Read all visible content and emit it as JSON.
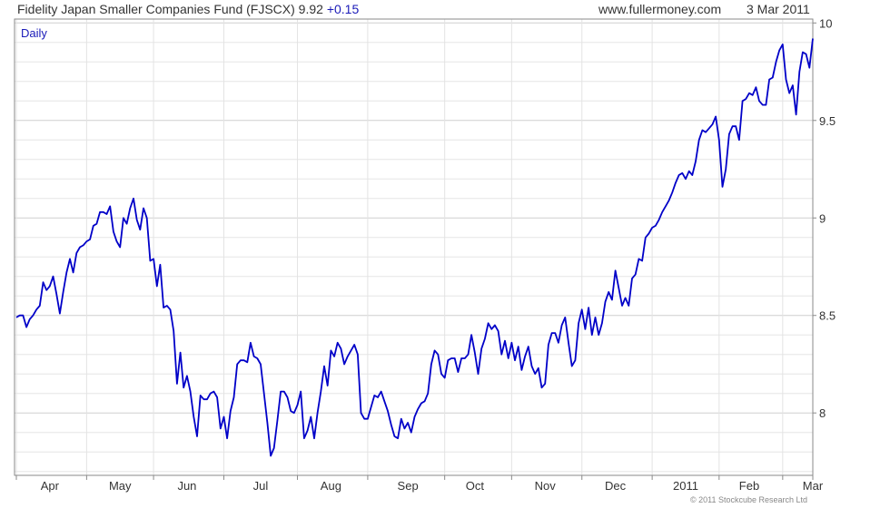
{
  "header": {
    "title": "Fidelity Japan Smaller Companies Fund (FJSCX) 9.92",
    "change": "+0.15",
    "site": "www.fullermoney.com",
    "date": "3 Mar 2011"
  },
  "credit": "© 2011 Stockcube Research Ltd",
  "chart_data": {
    "type": "line",
    "interval_label": "Daily",
    "ylim": [
      7.68,
      10.02
    ],
    "y_ticks": [
      8,
      8.5,
      9,
      9.5,
      10
    ],
    "y_tick_labels": [
      "8",
      "8.5",
      "9",
      "9.5",
      "10"
    ],
    "x_tick_labels": [
      "Apr",
      "May",
      "Jun",
      "Jul",
      "Aug",
      "Sep",
      "Oct",
      "Nov",
      "Dec",
      "2011",
      "Feb",
      "Mar"
    ],
    "grid": true,
    "line_color": "#0000c8",
    "series": [
      {
        "values": [
          8.49,
          8.5,
          8.5,
          8.44,
          8.48,
          8.5,
          8.53,
          8.55,
          8.67,
          8.63,
          8.65,
          8.7,
          8.61,
          8.51,
          8.62,
          8.72,
          8.79,
          8.72,
          8.82,
          8.85,
          8.86,
          8.88,
          8.89,
          8.96,
          8.97,
          9.03,
          9.03,
          9.02,
          9.06,
          8.93,
          8.88,
          8.85,
          9.0,
          8.97,
          9.05,
          9.1,
          8.99,
          8.94,
          9.05,
          9.0,
          8.78,
          8.79,
          8.65,
          8.76,
          8.54,
          8.55,
          8.53,
          8.42,
          8.15,
          8.31,
          8.13,
          8.19,
          8.11,
          7.98,
          7.88,
          8.09,
          8.07,
          8.07,
          8.1,
          8.11,
          8.08,
          7.92,
          7.98,
          7.87,
          8.01,
          8.08,
          8.25,
          8.27,
          8.27,
          8.26,
          8.36,
          8.29,
          8.28,
          8.25,
          8.1,
          7.95,
          7.78,
          7.82,
          7.96,
          8.11,
          8.11,
          8.08,
          8.01,
          8.0,
          8.04,
          8.11,
          7.87,
          7.91,
          7.98,
          7.87,
          8.0,
          8.11,
          8.24,
          8.14,
          8.32,
          8.29,
          8.36,
          8.33,
          8.25,
          8.29,
          8.32,
          8.35,
          8.3,
          8.0,
          7.97,
          7.97,
          8.03,
          8.09,
          8.08,
          8.11,
          8.06,
          8.01,
          7.94,
          7.88,
          7.87,
          7.97,
          7.92,
          7.95,
          7.9,
          7.98,
          8.02,
          8.05,
          8.06,
          8.1,
          8.25,
          8.32,
          8.3,
          8.2,
          8.18,
          8.27,
          8.28,
          8.28,
          8.21,
          8.28,
          8.28,
          8.3,
          8.4,
          8.31,
          8.2,
          8.33,
          8.38,
          8.46,
          8.43,
          8.45,
          8.42,
          8.3,
          8.37,
          8.28,
          8.36,
          8.27,
          8.34,
          8.22,
          8.29,
          8.34,
          8.24,
          8.2,
          8.23,
          8.13,
          8.15,
          8.35,
          8.41,
          8.41,
          8.36,
          8.45,
          8.49,
          8.36,
          8.24,
          8.27,
          8.46,
          8.53,
          8.43,
          8.54,
          8.4,
          8.49,
          8.4,
          8.46,
          8.57,
          8.62,
          8.58,
          8.73,
          8.64,
          8.55,
          8.59,
          8.55,
          8.69,
          8.71,
          8.79,
          8.78,
          8.9,
          8.92,
          8.95,
          8.96,
          8.99,
          9.03,
          9.06,
          9.09,
          9.13,
          9.18,
          9.22,
          9.23,
          9.2,
          9.24,
          9.22,
          9.29,
          9.4,
          9.45,
          9.44,
          9.46,
          9.48,
          9.52,
          9.4,
          9.16,
          9.25,
          9.43,
          9.47,
          9.47,
          9.4,
          9.6,
          9.61,
          9.64,
          9.63,
          9.67,
          9.6,
          9.58,
          9.58,
          9.71,
          9.72,
          9.8,
          9.86,
          9.89,
          9.71,
          9.64,
          9.68,
          9.53,
          9.75,
          9.85,
          9.84,
          9.77,
          9.92
        ]
      }
    ]
  }
}
